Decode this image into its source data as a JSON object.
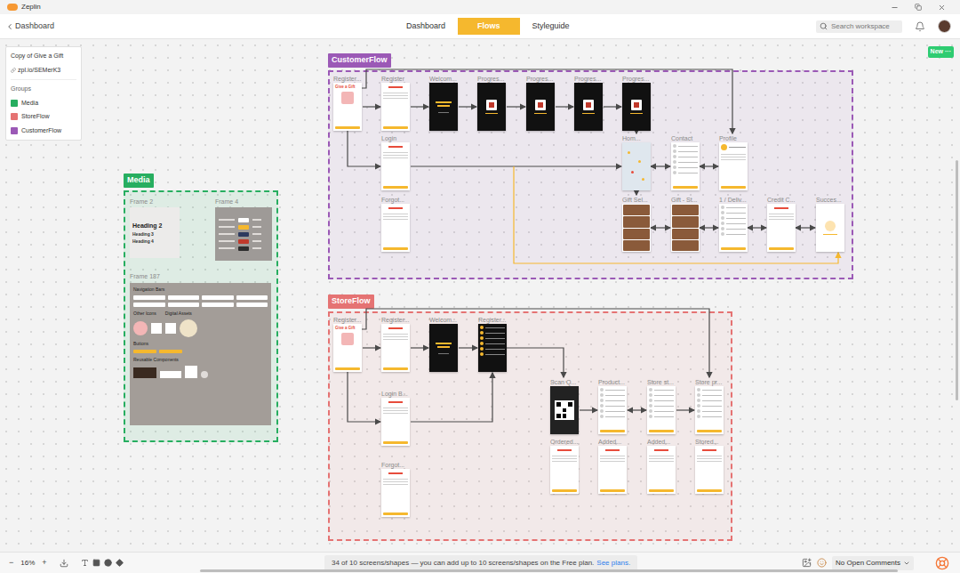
{
  "window": {
    "title": "Zeplin"
  },
  "nav": {
    "back": "Dashboard",
    "tabs": [
      {
        "label": "Dashboard",
        "selected": false
      },
      {
        "label": "Flows",
        "selected": true
      },
      {
        "label": "Styleguide",
        "selected": false
      }
    ],
    "search": {
      "placeholder": "Search workspace"
    }
  },
  "new_badge": {
    "label": "New",
    "more": "···"
  },
  "project_panel": {
    "name": "Copy of Give a Gift",
    "link": "zpl.io/SEMerK3",
    "groups_title": "Groups",
    "groups": [
      {
        "name": "Media",
        "color": "#27ae60"
      },
      {
        "name": "StoreFlow",
        "color": "#e57373"
      },
      {
        "name": "CustomerFlow",
        "color": "#9b59b6"
      }
    ]
  },
  "flows": [
    {
      "name": "CustomerFlow",
      "color": "#9b59b6",
      "screens": [
        {
          "label": "Register...",
          "kind": "register",
          "text": "Give a Gift"
        },
        {
          "label": "Register",
          "kind": "form"
        },
        {
          "label": "Welcom...",
          "kind": "dark"
        },
        {
          "label": "Progres...",
          "kind": "darkgift"
        },
        {
          "label": "Progres...",
          "kind": "darkgift"
        },
        {
          "label": "Progres...",
          "kind": "darkgift"
        },
        {
          "label": "Progres...",
          "kind": "darkgift"
        },
        {
          "label": "Login",
          "kind": "form"
        },
        {
          "label": "Hom...",
          "kind": "map"
        },
        {
          "label": "Contact",
          "kind": "list"
        },
        {
          "label": "Profile",
          "kind": "profile"
        },
        {
          "label": "Forgot...",
          "kind": "form"
        },
        {
          "label": "Gift Sel...",
          "kind": "photos"
        },
        {
          "label": "Gift - St...",
          "kind": "photos"
        },
        {
          "label": "1 / Deliv...",
          "kind": "list"
        },
        {
          "label": "Credit C...",
          "kind": "form"
        },
        {
          "label": "Succes...",
          "kind": "success"
        }
      ]
    },
    {
      "name": "StoreFlow",
      "color": "#e57373",
      "screens": [
        {
          "label": "Register...",
          "kind": "register",
          "text": "Give a Gift"
        },
        {
          "label": "Register...",
          "kind": "form"
        },
        {
          "label": "Welcom...",
          "kind": "dark"
        },
        {
          "label": "Register...",
          "kind": "darklist"
        },
        {
          "label": "Login B...",
          "kind": "form"
        },
        {
          "label": "Forgot...",
          "kind": "form"
        },
        {
          "label": "Scan Q...",
          "kind": "qr"
        },
        {
          "label": "Product...",
          "kind": "list"
        },
        {
          "label": "Store st...",
          "kind": "list"
        },
        {
          "label": "Store pr...",
          "kind": "list"
        },
        {
          "label": "Ordered...",
          "kind": "form"
        },
        {
          "label": "Added...",
          "kind": "form"
        },
        {
          "label": "Added...",
          "kind": "form"
        },
        {
          "label": "Stored...",
          "kind": "form"
        }
      ]
    }
  ],
  "media": {
    "name": "Media",
    "color": "#27ae60",
    "frame_typography": {
      "label": "Frame 2",
      "texts": [
        "Heading 2",
        "Heading 3",
        "Heading 4"
      ]
    },
    "frame_colors": {
      "label": "Frame 4",
      "swatches": [
        {
          "color": "#ffffff"
        },
        {
          "color": "#f5b82e"
        },
        {
          "color": "#2d3a5e"
        },
        {
          "color": "#c0392b"
        },
        {
          "color": "#2d2d2d"
        }
      ]
    },
    "frame_components": {
      "label": "Frame 187",
      "sections": [
        "Navigation Bars",
        "Other Icons",
        "Digital Assets",
        "Buttons",
        "Reusable Components"
      ]
    }
  },
  "status_bar": {
    "zoom_out": "−",
    "zoom": "16%",
    "zoom_in": "+",
    "message": "34 of 10 screens/shapes — you can add up to 10 screens/shapes on the Free plan.",
    "link": "See plans.",
    "comments": "No Open Comments"
  }
}
